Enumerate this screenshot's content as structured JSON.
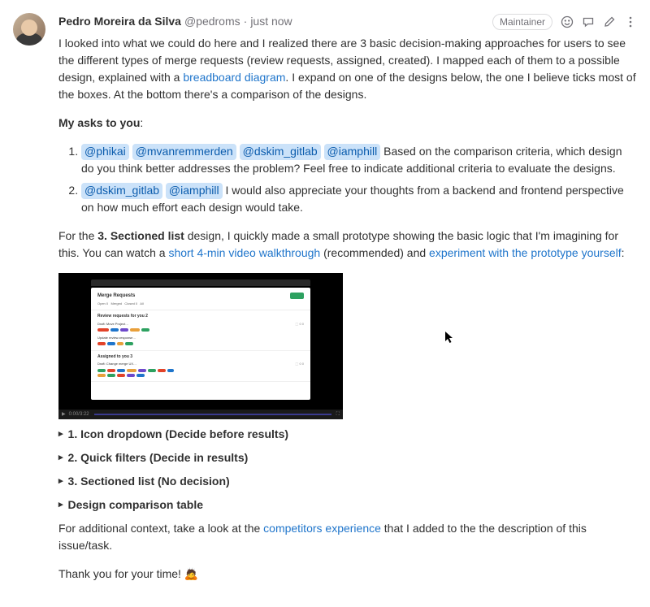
{
  "author": {
    "name": "Pedro Moreira da Silva",
    "handle": "@pedroms",
    "time": "just now"
  },
  "badge": "Maintainer",
  "para1_a": "I looked into what we could do here and I realized there are 3 basic decision-making approaches for users to see the different types of merge requests (review requests, assigned, created). I mapped each of them to a possible design, explained with a ",
  "para1_link": "breadboard diagram",
  "para1_b": ". I expand on one of the designs below, the one I believe ticks most of the boxes. At the bottom there's a comparison of the designs.",
  "asks_label": "My asks to you",
  "mentions": {
    "phikai": "@phikai",
    "mvanremmerden": "@mvanremmerden",
    "dskim": "@dskim_gitlab",
    "iamphill": "@iamphill"
  },
  "li1_rest": " Based on the comparison criteria, which design do you think better addresses the problem? Feel free to indicate additional criteria to evaluate the designs.",
  "li2_rest": " I would also appreciate your thoughts from a backend and frontend perspective on how much effort each design would take.",
  "para3_a": "For the ",
  "para3_bold": "3. Sectioned list",
  "para3_b": " design, I quickly made a small prototype showing the basic logic that I'm imagining for this. You can watch a ",
  "para3_link1": "short 4-min video walkthrough",
  "para3_c": " (recommended) and ",
  "para3_link2": "experiment with the prototype yourself",
  "para3_d": ":",
  "video": {
    "title": "Merge Requests"
  },
  "details": {
    "d1": "1. Icon dropdown (Decide before results)",
    "d2": "2. Quick filters (Decide in results)",
    "d3": "3. Sectioned list (No decision)",
    "d4": "Design comparison table"
  },
  "para4_a": "For additional context, take a look at the ",
  "para4_link": "competitors experience",
  "para4_b": " that I added to the the description of this issue/task.",
  "para5": "Thank you for your time! ",
  "emoji": "🙇"
}
